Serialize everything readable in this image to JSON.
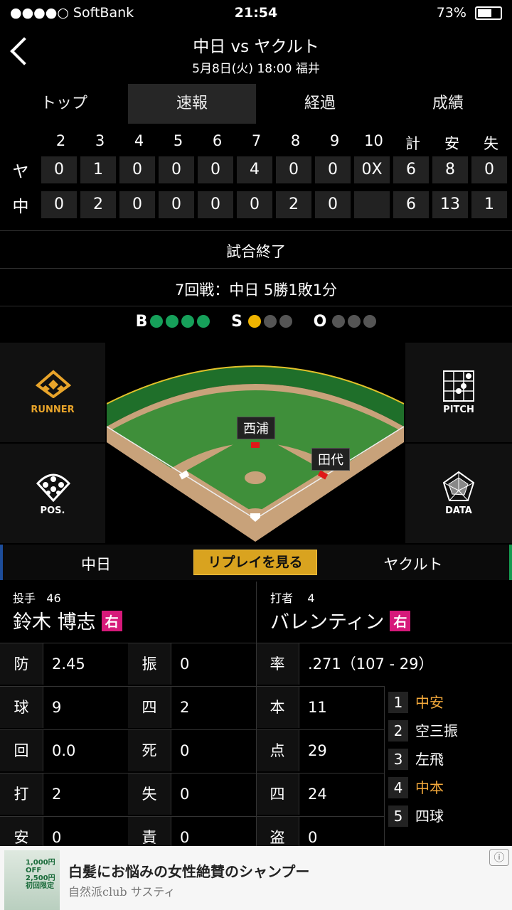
{
  "status": {
    "carrier": "●●●●○ SoftBank",
    "time": "21:54",
    "battery": "73%",
    "battery_level": 0.73
  },
  "header": {
    "title": "中日 vs ヤクルト",
    "subtitle": "5月8日(火) 18:00 福井"
  },
  "tabs": [
    "トップ",
    "速報",
    "経過",
    "成績"
  ],
  "scoreboard": {
    "columns": [
      "2",
      "3",
      "4",
      "5",
      "6",
      "7",
      "8",
      "9",
      "10",
      "計",
      "安",
      "失"
    ],
    "rows": [
      {
        "team": "ヤ",
        "cells": [
          "0",
          "1",
          "0",
          "0",
          "0",
          "4",
          "0",
          "0",
          "0X",
          "6",
          "8",
          "0"
        ]
      },
      {
        "team": "中",
        "cells": [
          "0",
          "2",
          "0",
          "0",
          "0",
          "0",
          "2",
          "0",
          "",
          "6",
          "13",
          "1"
        ]
      }
    ]
  },
  "game_status": "試合終了",
  "series": "7回戦：中日 5勝1敗1分",
  "bso": {
    "b_label": "B",
    "s_label": "S",
    "o_label": "O",
    "balls": 4,
    "strikes": 1,
    "outs": 0,
    "ball_color": "#16a05a",
    "strike_color": "#f0b400",
    "off_color": "#555555"
  },
  "side_buttons": {
    "runner": "RUNNER",
    "pitch": "PITCH",
    "pos": "POS.",
    "data": "DATA"
  },
  "field": {
    "player1": "西浦",
    "player2": "田代"
  },
  "teambar": {
    "home": "中日",
    "replay": "リプレイを見る",
    "away": "ヤクルト"
  },
  "pitcher": {
    "label": "投手",
    "number": "46",
    "name": "鈴木 博志",
    "hand": "右"
  },
  "batter": {
    "label": "打者",
    "number": "4",
    "name": "バレンティン",
    "hand": "右"
  },
  "pitcher_stats": [
    {
      "k1": "防",
      "v1": "2.45",
      "k2": "振",
      "v2": "0"
    },
    {
      "k1": "球",
      "v1": "9",
      "k2": "四",
      "v2": "2"
    },
    {
      "k1": "回",
      "v1": "0.0",
      "k2": "死",
      "v2": "0"
    },
    {
      "k1": "打",
      "v1": "2",
      "k2": "失",
      "v2": "0"
    },
    {
      "k1": "安",
      "v1": "0",
      "k2": "責",
      "v2": "0"
    }
  ],
  "batter_stats": {
    "avg_key": "率",
    "avg_val": ".271（107 - 29）",
    "rows": [
      {
        "k": "本",
        "v": "11"
      },
      {
        "k": "点",
        "v": "29"
      },
      {
        "k": "四",
        "v": "24"
      },
      {
        "k": "盗",
        "v": "0"
      }
    ]
  },
  "at_bats": [
    {
      "n": "1",
      "result": "中安",
      "highlight": true
    },
    {
      "n": "2",
      "result": "空三振",
      "highlight": false
    },
    {
      "n": "3",
      "result": "左飛",
      "highlight": false
    },
    {
      "n": "4",
      "result": "中本",
      "highlight": true
    },
    {
      "n": "5",
      "result": "四球",
      "highlight": false
    }
  ],
  "ad": {
    "headline": "白髪にお悩みの女性絶賛のシャンプー",
    "sponsor": "自然派club サスティ",
    "image_text": "1,000円OFF 2,500円 初回限定"
  }
}
